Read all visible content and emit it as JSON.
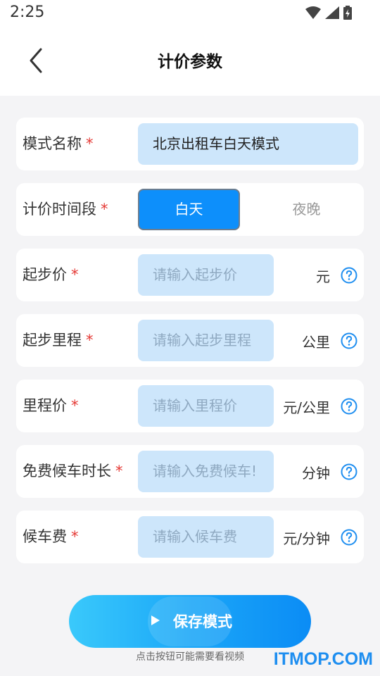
{
  "status_bar": {
    "time": "2:25"
  },
  "header": {
    "title": "计价参数"
  },
  "form": {
    "mode_name": {
      "label": "模式名称",
      "required": "*",
      "value": "北京出租车白天模式"
    },
    "period": {
      "label": "计价时间段",
      "required": "*",
      "options": [
        "白天",
        "夜晚"
      ],
      "selected": "白天"
    },
    "rows": [
      {
        "label": "起步价",
        "required": "*",
        "placeholder": "请输入起步价",
        "unit": "元"
      },
      {
        "label": "起步里程",
        "required": "*",
        "placeholder": "请输入起步里程",
        "unit": "公里"
      },
      {
        "label": "里程价",
        "required": "*",
        "placeholder": "请输入里程价",
        "unit": "元/公里"
      },
      {
        "label": "免费候车时长",
        "required": "*",
        "placeholder": "请输入免费候车!",
        "unit": "分钟"
      },
      {
        "label": "候车费",
        "required": "*",
        "placeholder": "请输入候车费",
        "unit": "元/分钟"
      }
    ]
  },
  "save_button": {
    "label": "保存模式"
  },
  "hint": "点击按钮可能需要看视频",
  "watermark": "ITMOP.COM",
  "colors": {
    "accent": "#0d8ffb",
    "input_bg": "#cde6fb",
    "required": "#e53935"
  },
  "icons": [
    "wifi-icon",
    "signal-icon",
    "battery-icon",
    "back-arrow-icon",
    "help-icon",
    "play-icon"
  ]
}
